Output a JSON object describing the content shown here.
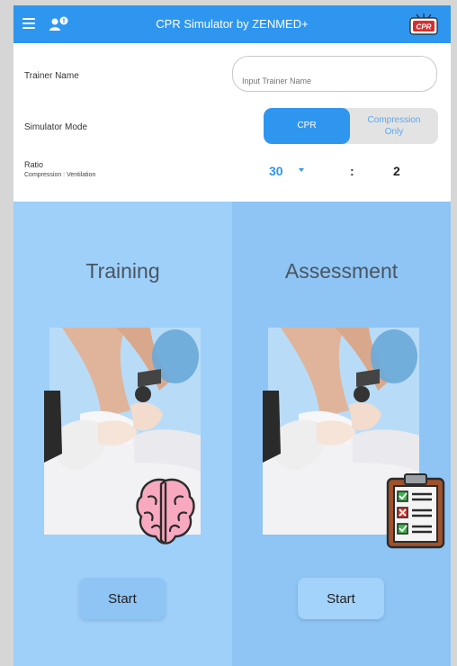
{
  "header": {
    "title": "CPR Simulator by ZENMED+",
    "menu_icon": "hamburger-menu-icon",
    "user_icon": "user-add-icon",
    "logo_icon": "cpr-logo-icon",
    "accent": "#2f96f0"
  },
  "form": {
    "trainer_label": "Trainer Name",
    "trainer_placeholder": "Input Trainer Name",
    "trainer_value": "",
    "mode_label": "Simulator Mode",
    "mode_cpr": "CPR",
    "mode_compression_line1": "Compression",
    "mode_compression_line2": "Only",
    "mode_selected": "CPR",
    "ratio_label": "Ratio",
    "ratio_sublabel": "Compression : Ventilation",
    "ratio_compression": "30",
    "ratio_separator": ":",
    "ratio_ventilation": "2"
  },
  "training": {
    "title": "Training",
    "start_label": "Start",
    "badge_icon": "brain-icon",
    "image": "cpr-training-photo"
  },
  "assessment": {
    "title": "Assessment",
    "start_label": "Start",
    "badge_icon": "clipboard-checklist-icon",
    "image": "cpr-assessment-photo"
  }
}
